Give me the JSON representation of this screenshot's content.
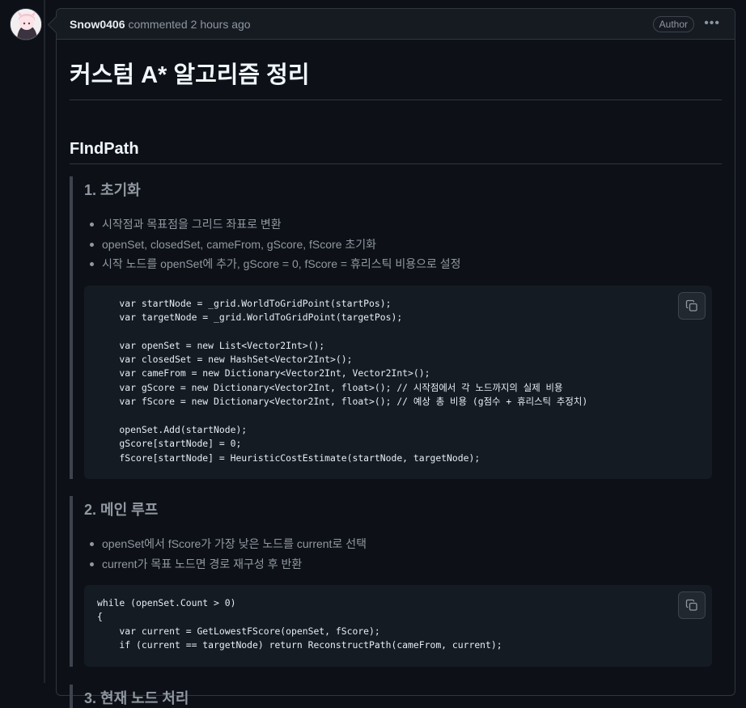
{
  "comment": {
    "author": "Snow0406",
    "action": "commented",
    "time": "2 hours ago",
    "badge": "Author",
    "menu_icon": "kebab-horizontal-icon"
  },
  "title": "커스텀 A* 알고리즘 정리",
  "section_title": "FIndPath",
  "steps": [
    {
      "heading": "1. 초기화",
      "bullets": [
        "시작점과 목표점을 그리드 좌표로 변환",
        "openSet, closedSet, cameFrom, gScore, fScore 초기화",
        "시작 노드를 openSet에 추가, gScore = 0, fScore = 휴리스틱 비용으로 설정"
      ],
      "code": [
        "    var startNode = _grid.WorldToGridPoint(startPos);",
        "    var targetNode = _grid.WorldToGridPoint(targetPos);",
        "",
        "    var openSet = new List<Vector2Int>();",
        "    var closedSet = new HashSet<Vector2Int>();",
        "    var cameFrom = new Dictionary<Vector2Int, Vector2Int>();",
        "    var gScore = new Dictionary<Vector2Int, float>(); // 시작점에서 각 노드까지의 실제 비용",
        "    var fScore = new Dictionary<Vector2Int, float>(); // 예상 총 비용 (g점수 + 휴리스틱 추정치)",
        "",
        "    openSet.Add(startNode);",
        "    gScore[startNode] = 0;",
        "    fScore[startNode] = HeuristicCostEstimate(startNode, targetNode);"
      ]
    },
    {
      "heading": "2. 메인 루프",
      "bullets": [
        "openSet에서 fScore가 가장 낮은 노드를 current로 선택",
        "current가 목표 노드면 경로 재구성 후 반환"
      ],
      "code": [
        "while (openSet.Count > 0)",
        "{",
        "    var current = GetLowestFScore(openSet, fScore);",
        "    if (current == targetNode) return ReconstructPath(cameFrom, current);"
      ]
    },
    {
      "heading": "3. 현재 노드 처리"
    }
  ],
  "colors": {
    "background": "#0d1117",
    "header_bg": "#161b22",
    "border": "#30363d",
    "muted_text": "#9198a1",
    "code_bg": "#151b23"
  }
}
